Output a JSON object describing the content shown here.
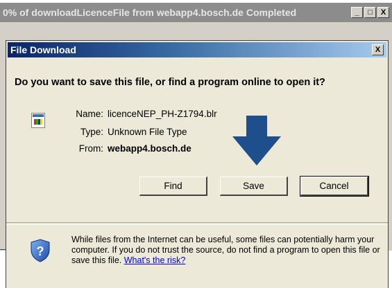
{
  "background_window": {
    "title": "0% of downloadLicenceFile from webapp4.bosch.de Completed",
    "controls": [
      "_",
      "□",
      "X"
    ]
  },
  "dialog": {
    "title": "File Download",
    "close_label": "X",
    "question": "Do you want to save this file, or find a program online to open it?",
    "file": {
      "name_label": "Name:",
      "name": "licenceNEP_PH-Z1794.blr",
      "type_label": "Type:",
      "type": "Unknown File Type",
      "from_label": "From:",
      "from": "webapp4.bosch.de"
    },
    "buttons": {
      "find": "Find",
      "save": "Save",
      "cancel": "Cancel"
    },
    "warning_text": "While files from the Internet can be useful, some files can potentially harm your computer. If you do not trust the source, do not find a program to open this file or save this file.",
    "risk_link": "What's the risk?"
  },
  "colors": {
    "titlebar_active": "#0a246a",
    "arrow": "#1f4e8c",
    "face": "#ece9d8"
  }
}
